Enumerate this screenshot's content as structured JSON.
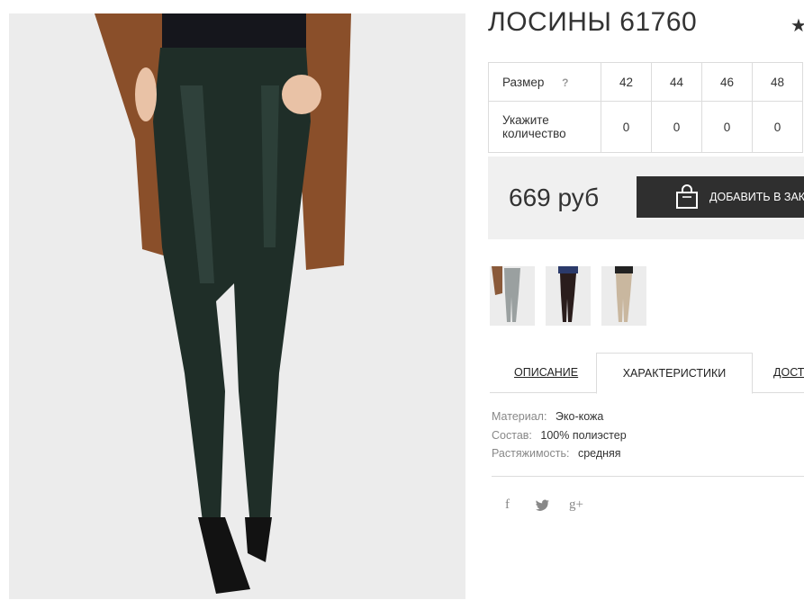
{
  "product": {
    "title": "ЛОСИНЫ 61760"
  },
  "size_table": {
    "size_label": "Размер",
    "help_symbol": "?",
    "sizes": [
      "42",
      "44",
      "46",
      "48"
    ],
    "quantity_label_line1": "Укажите",
    "quantity_label_line2": "количество",
    "quantities": [
      "0",
      "0",
      "0",
      "0"
    ]
  },
  "purchase": {
    "price": "669 руб",
    "add_to_cart_label": "ДОБАВИТЬ В ЗАКАЗ"
  },
  "tabs": {
    "description": "ОПИСАНИЕ",
    "characteristics": "ХАРАКТЕРИСТИКИ",
    "delivery": "ДОСТАВКА"
  },
  "characteristics": [
    {
      "label": "Материал:",
      "value": "Эко-кожа"
    },
    {
      "label": "Состав:",
      "value": "100% полиэстер"
    },
    {
      "label": "Растяжимость:",
      "value": "средняя"
    }
  ],
  "social": {
    "facebook": "f",
    "twitter": "🐦",
    "google_plus": "g+"
  },
  "icons": {
    "favorite": "star-icon",
    "cart": "shopping-bag-icon"
  },
  "colors": {
    "button_bg": "#2f2f2f",
    "panel_bg": "#f0f0f0",
    "leggings": "#1f2e28",
    "coat": "#8a4f2a"
  }
}
